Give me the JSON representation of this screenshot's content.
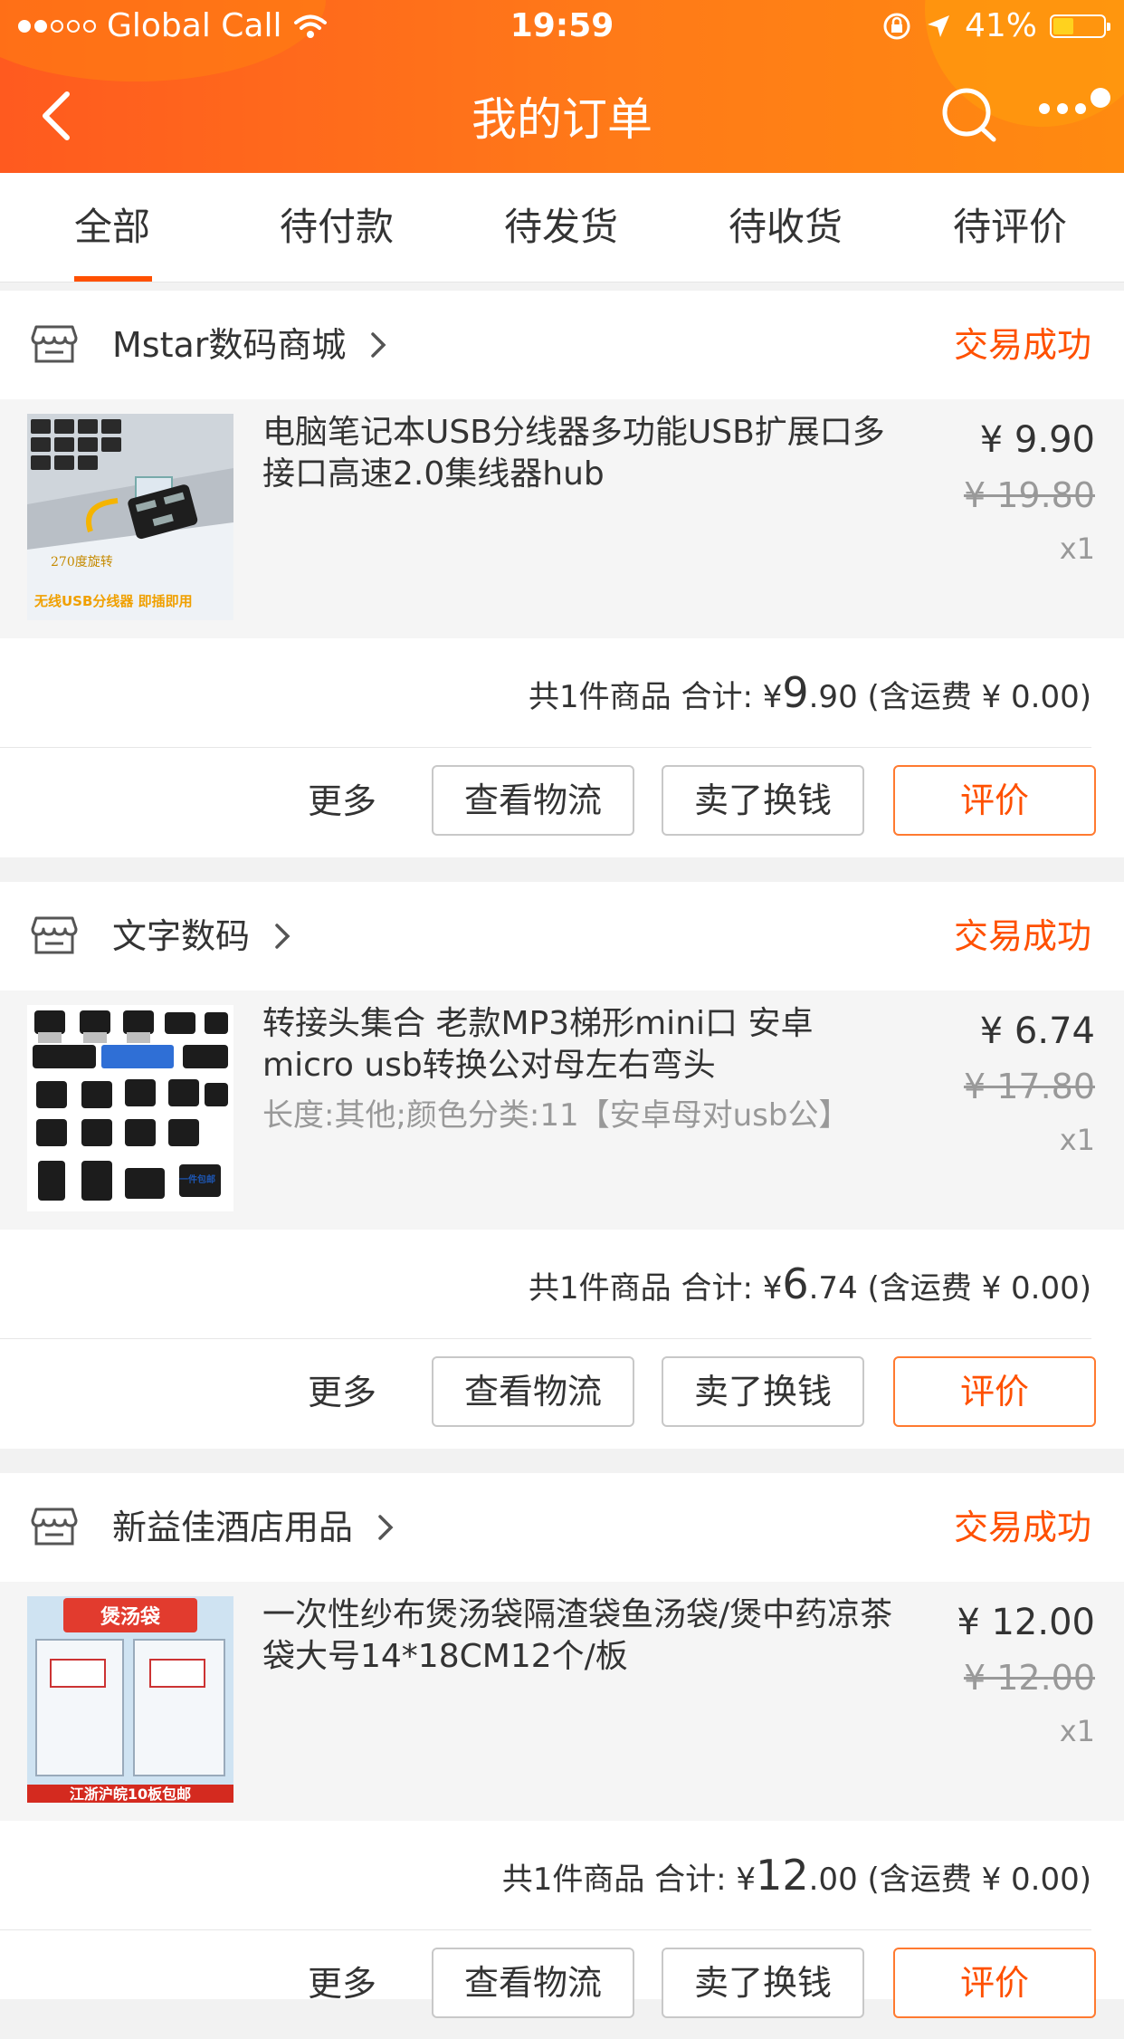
{
  "status_bar": {
    "carrier": "Global Call",
    "time": "19:59",
    "battery": "41%",
    "battery_level": 0.41,
    "signal_bars_filled": 2,
    "signal_bars_total": 5
  },
  "nav": {
    "title": "我的订单",
    "back_icon": "chevron-left-icon",
    "search_icon": "search-icon",
    "more_icon": "more-dots-icon"
  },
  "tabs": [
    {
      "label": "全部",
      "active": true
    },
    {
      "label": "待付款",
      "active": false
    },
    {
      "label": "待发货",
      "active": false
    },
    {
      "label": "待收货",
      "active": false
    },
    {
      "label": "待评价",
      "active": false
    }
  ],
  "colors": {
    "accent": "#ff5000",
    "header_start": "#ff5a1f",
    "header_end": "#ff8a10"
  },
  "orders": [
    {
      "shop": "Mstar数码商城",
      "status": "交易成功",
      "item_title": "电脑笔记本USB分线器多功能USB扩展口多接口高速2.0集线器hub",
      "sku": "",
      "price": "¥ 9.90",
      "original_price": "¥ 19.80",
      "qty": "x1",
      "summary_prefix": "共1件商品 合计: ¥",
      "total_int": "9",
      "total_dec": ".90",
      "shipping": "(含运费 ¥ 0.00)",
      "thumb_text_1": "270度旋转",
      "thumb_text_2": "无线USB分线器 即插即用"
    },
    {
      "shop": "文字数码",
      "status": "交易成功",
      "item_title": "转接头集合 老款MP3梯形mini口 安卓micro usb转换公对母左右弯头",
      "sku": "长度:其他;颜色分类:11【安卓母对usb公】",
      "price": "¥ 6.74",
      "original_price": "¥ 17.80",
      "qty": "x1",
      "summary_prefix": "共1件商品 合计: ¥",
      "total_int": "6",
      "total_dec": ".74",
      "shipping": "(含运费 ¥ 0.00)",
      "thumb_text_1": "一件包邮",
      "thumb_text_2": ""
    },
    {
      "shop": "新益佳酒店用品",
      "status": "交易成功",
      "item_title": "一次性纱布煲汤袋隔渣袋鱼汤袋/煲中药凉茶袋大号14*18CM12个/板",
      "sku": "",
      "price": "¥ 12.00",
      "original_price": "¥ 12.00",
      "qty": "x1",
      "summary_prefix": "共1件商品 合计: ¥",
      "total_int": "12",
      "total_dec": ".00",
      "shipping": "(含运费 ¥ 0.00)",
      "thumb_text_1": "煲汤袋",
      "thumb_text_2": "江浙沪皖10板包邮"
    }
  ],
  "actions": {
    "more": "更多",
    "logistics": "查看物流",
    "resell": "卖了换钱",
    "review": "评价"
  }
}
